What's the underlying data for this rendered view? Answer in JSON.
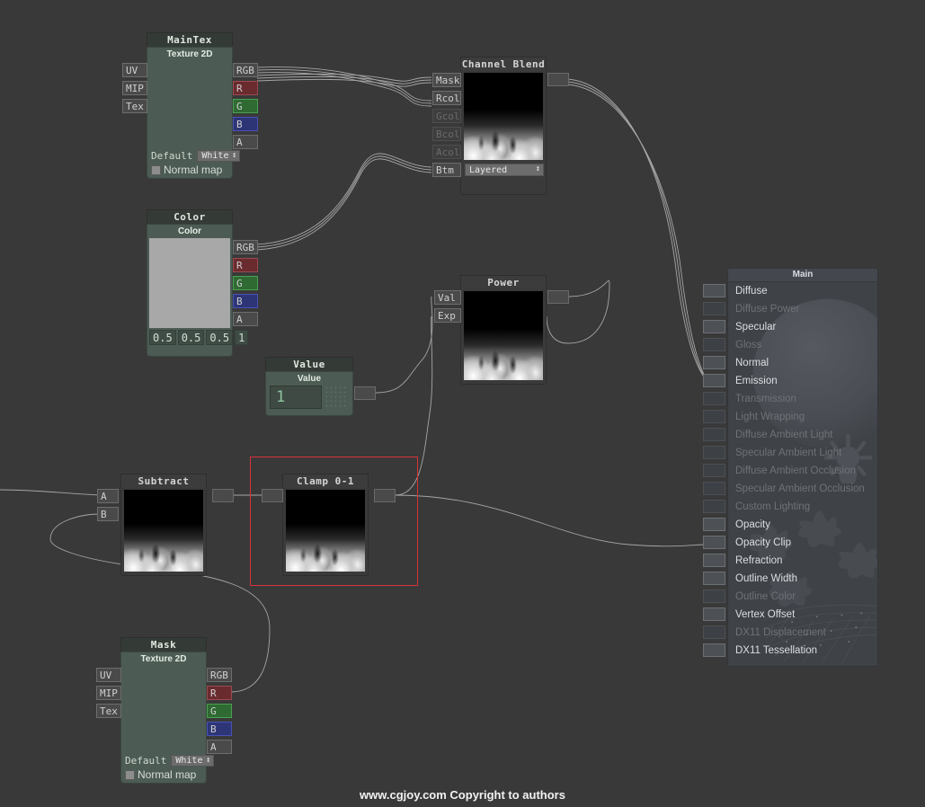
{
  "app": {
    "background_color": "#393939",
    "footer": "www.cgjoy.com  Copyright to authors"
  },
  "nodes": {
    "maintex": {
      "title": "MainTex",
      "subtitle": "Texture 2D",
      "inputs": [
        "UV",
        "MIP",
        "Tex"
      ],
      "outputs": [
        "RGB",
        "R",
        "G",
        "B",
        "A"
      ],
      "default_label": "Default",
      "default_value": "White",
      "normalmap_label": "Normal map"
    },
    "color": {
      "title": "Color",
      "subtitle": "Color",
      "outputs": [
        "RGB",
        "R",
        "G",
        "B",
        "A"
      ],
      "values": [
        "0.5",
        "0.5",
        "0.5",
        "1"
      ],
      "swatch_color": "#a8a8a8"
    },
    "value": {
      "title": "Value",
      "subtitle": "Value",
      "field_value": "1"
    },
    "channel_blend": {
      "title": "Channel Blend",
      "inputs": [
        "Mask",
        "Rcol",
        "Gcol",
        "Bcol",
        "Acol",
        "Btm"
      ],
      "disabled_inputs": [
        "Gcol",
        "Bcol",
        "Acol"
      ],
      "dropdown_value": "Layered"
    },
    "power": {
      "title": "Power",
      "inputs": [
        "Val",
        "Exp"
      ]
    },
    "subtract": {
      "title": "Subtract",
      "inputs": [
        "A",
        "B"
      ]
    },
    "clamp": {
      "title": "Clamp 0-1",
      "selected": true,
      "selection_color": "#d8323a"
    },
    "mask": {
      "title": "Mask",
      "subtitle": "Texture 2D",
      "inputs": [
        "UV",
        "MIP",
        "Tex"
      ],
      "outputs": [
        "RGB",
        "R",
        "G",
        "B",
        "A"
      ],
      "default_label": "Default",
      "default_value": "White",
      "normalmap_label": "Normal map"
    },
    "main": {
      "title": "Main",
      "rows": [
        {
          "label": "Diffuse",
          "enabled": true
        },
        {
          "label": "Diffuse Power",
          "enabled": false
        },
        {
          "label": "Specular",
          "enabled": true
        },
        {
          "label": "Gloss",
          "enabled": false
        },
        {
          "label": "Normal",
          "enabled": true
        },
        {
          "label": "Emission",
          "enabled": true
        },
        {
          "label": "Transmission",
          "enabled": false
        },
        {
          "label": "Light Wrapping",
          "enabled": false
        },
        {
          "label": "Diffuse Ambient Light",
          "enabled": false
        },
        {
          "label": "Specular Ambient Light",
          "enabled": false
        },
        {
          "label": "Diffuse Ambient Occlusion",
          "enabled": false
        },
        {
          "label": "Specular Ambient Occlusion",
          "enabled": false
        },
        {
          "label": "Custom Lighting",
          "enabled": false
        },
        {
          "label": "Opacity",
          "enabled": true
        },
        {
          "label": "Opacity Clip",
          "enabled": true
        },
        {
          "label": "Refraction",
          "enabled": true
        },
        {
          "label": "Outline Width",
          "enabled": true
        },
        {
          "label": "Outline Color",
          "enabled": false
        },
        {
          "label": "Vertex Offset",
          "enabled": true
        },
        {
          "label": "DX11 Displacement",
          "enabled": false
        },
        {
          "label": "DX11 Tessellation",
          "enabled": true
        }
      ]
    }
  }
}
